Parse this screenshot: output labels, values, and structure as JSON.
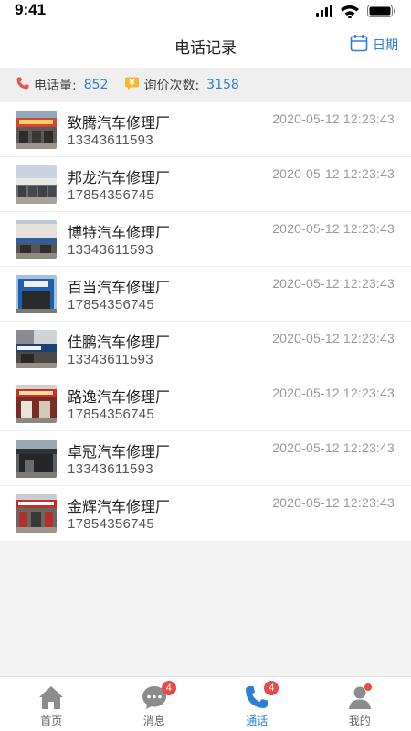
{
  "status_bar": {
    "time": "9:41"
  },
  "header": {
    "title": "电话记录",
    "date_label": "日期"
  },
  "stats": {
    "calls_label": "电话量:",
    "calls_value": "852",
    "inquiry_label": "询价次数:",
    "inquiry_value": "3158"
  },
  "records": [
    {
      "name": "致腾汽车修理厂",
      "phone": "13343611593",
      "time": "2020-05-12 12:23:43"
    },
    {
      "name": "邦龙汽车修理厂",
      "phone": "17854356745",
      "time": "2020-05-12 12:23:43"
    },
    {
      "name": "博特汽车修理厂",
      "phone": "13343611593",
      "time": "2020-05-12 12:23:43"
    },
    {
      "name": "百当汽车修理厂",
      "phone": "17854356745",
      "time": "2020-05-12 12:23:43"
    },
    {
      "name": "佳鹏汽车修理厂",
      "phone": "13343611593",
      "time": "2020-05-12 12:23:43"
    },
    {
      "name": "路逸汽车修理厂",
      "phone": "17854356745",
      "time": "2020-05-12 12:23:43"
    },
    {
      "name": "卓冠汽车修理厂",
      "phone": "13343611593",
      "time": "2020-05-12 12:23:43"
    },
    {
      "name": "金辉汽车修理厂",
      "phone": "17854356745",
      "time": "2020-05-12 12:23:43"
    }
  ],
  "tabs": [
    {
      "label": "首页",
      "icon": "home-icon",
      "badge": ""
    },
    {
      "label": "消息",
      "icon": "message-icon",
      "badge": "4"
    },
    {
      "label": "通话",
      "icon": "phone-icon",
      "badge": "4",
      "active": true
    },
    {
      "label": "我的",
      "icon": "profile-icon",
      "badge": ""
    }
  ],
  "colors": {
    "accent": "#2b7fd6",
    "badge": "#e84a4a",
    "phone_icon": "#e35a4a",
    "inquiry_icon": "#f4b633"
  }
}
